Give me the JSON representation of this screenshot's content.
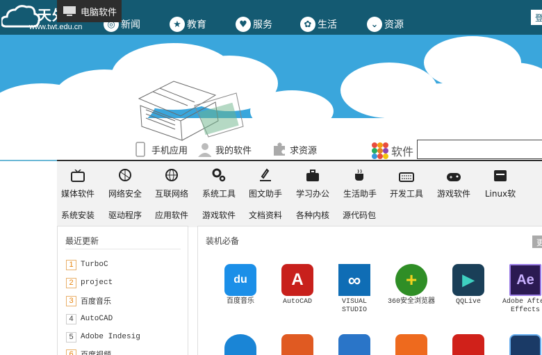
{
  "header": {
    "logo_title": "天外天",
    "logo_url": "www.twt.edu.cn",
    "nav": [
      "新闻",
      "教育",
      "服务",
      "生活",
      "资源"
    ],
    "login": "登"
  },
  "tabs": [
    "电脑软件",
    "手机应用",
    "我的软件",
    "求资源"
  ],
  "search": {
    "label": "软件",
    "placeholder": ""
  },
  "categories": [
    "媒体软件",
    "网络安全",
    "互联网络",
    "系统工具",
    "图文助手",
    "学习办公",
    "生活助手",
    "开发工具",
    "游戏软件",
    "Linux软"
  ],
  "subcategories": [
    "系统安装",
    "驱动程序",
    "应用软件",
    "游戏软件",
    "文档资料",
    "各种内核",
    "源代码包"
  ],
  "recent": {
    "title": "最近更新",
    "items": [
      {
        "rank": "1",
        "name": "TurboC"
      },
      {
        "rank": "2",
        "name": "project"
      },
      {
        "rank": "3",
        "name": "百度音乐"
      },
      {
        "rank": "4",
        "name": "AutoCAD"
      },
      {
        "rank": "5",
        "name": "Adobe Indesig"
      },
      {
        "rank": "6",
        "name": "百度视频"
      }
    ]
  },
  "essential": {
    "title": "装机必备",
    "more": "更",
    "apps": [
      {
        "name": "百度音乐",
        "icon_text": "du",
        "color": "#1b8fe8"
      },
      {
        "name": "AutoCAD",
        "icon_text": "A",
        "color": "#c8201c"
      },
      {
        "name": "VISUAL STUDIO",
        "icon_text": "∞",
        "color": "#0f6db5"
      },
      {
        "name": "360安全浏览器",
        "icon_text": "+",
        "color": "#2f8e26"
      },
      {
        "name": "QQLive",
        "icon_text": "▶",
        "color": "#1a3f58"
      },
      {
        "name": "Adobe After Effects",
        "icon_text": "Ae",
        "color": "#2b1a52"
      }
    ],
    "row2_colors": [
      "#1a85d6",
      "#e05a22",
      "#2a75c8",
      "#ee6a1e",
      "#d0211a",
      "#1a3a66"
    ]
  },
  "colors": {
    "header": "#145a72",
    "sky": "#3aa6dc",
    "tab_active": "#2e2e2e"
  }
}
